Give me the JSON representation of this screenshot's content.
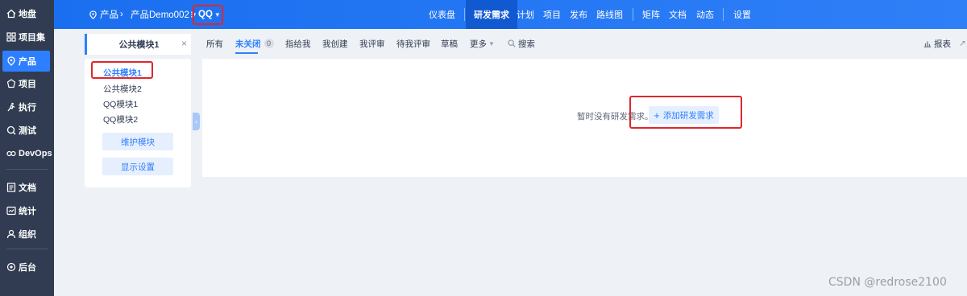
{
  "sidebar": {
    "items": [
      {
        "label": "地盘",
        "icon": "home-icon"
      },
      {
        "label": "项目集",
        "icon": "grid-icon"
      },
      {
        "label": "产品",
        "icon": "product-icon",
        "active": true
      },
      {
        "label": "项目",
        "icon": "project-icon"
      },
      {
        "label": "执行",
        "icon": "run-icon"
      },
      {
        "label": "测试",
        "icon": "test-icon"
      },
      {
        "label": "DevOps",
        "icon": "devops-icon"
      },
      {
        "label": "文档",
        "icon": "doc-icon"
      },
      {
        "label": "统计",
        "icon": "chart-icon"
      },
      {
        "label": "组织",
        "icon": "org-icon"
      },
      {
        "label": "后台",
        "icon": "settings-icon"
      }
    ]
  },
  "header": {
    "breadcrumb_root": "产品",
    "product_name": "产品Demo002",
    "branch_name": "QQ",
    "nav": [
      "仪表盘",
      "研发需求",
      "计划",
      "项目",
      "发布",
      "路线图",
      "矩阵",
      "文档",
      "动态",
      "设置"
    ],
    "active_nav": "研发需求"
  },
  "filters": {
    "module_tab": "公共模块1",
    "items": [
      "所有",
      "未关闭",
      "指给我",
      "我创建",
      "我评审",
      "待我评审",
      "草稿",
      "更多",
      "搜索"
    ],
    "active": "未关闭",
    "count": "0",
    "report": "报表"
  },
  "module_panel": {
    "items": [
      "公共模块1",
      "公共模块2",
      "QQ模块1",
      "QQ模块2"
    ],
    "active": "公共模块1",
    "maintain_button": "维护模块",
    "display_button": "显示设置"
  },
  "main": {
    "empty_text": "暂时没有研发需求。",
    "add_button": "添加研发需求"
  },
  "watermark": "CSDN @redrose2100",
  "colors": {
    "sidebar_bg": "#313c52",
    "accent": "#2e7fff",
    "highlight_box": "#e0262b"
  }
}
